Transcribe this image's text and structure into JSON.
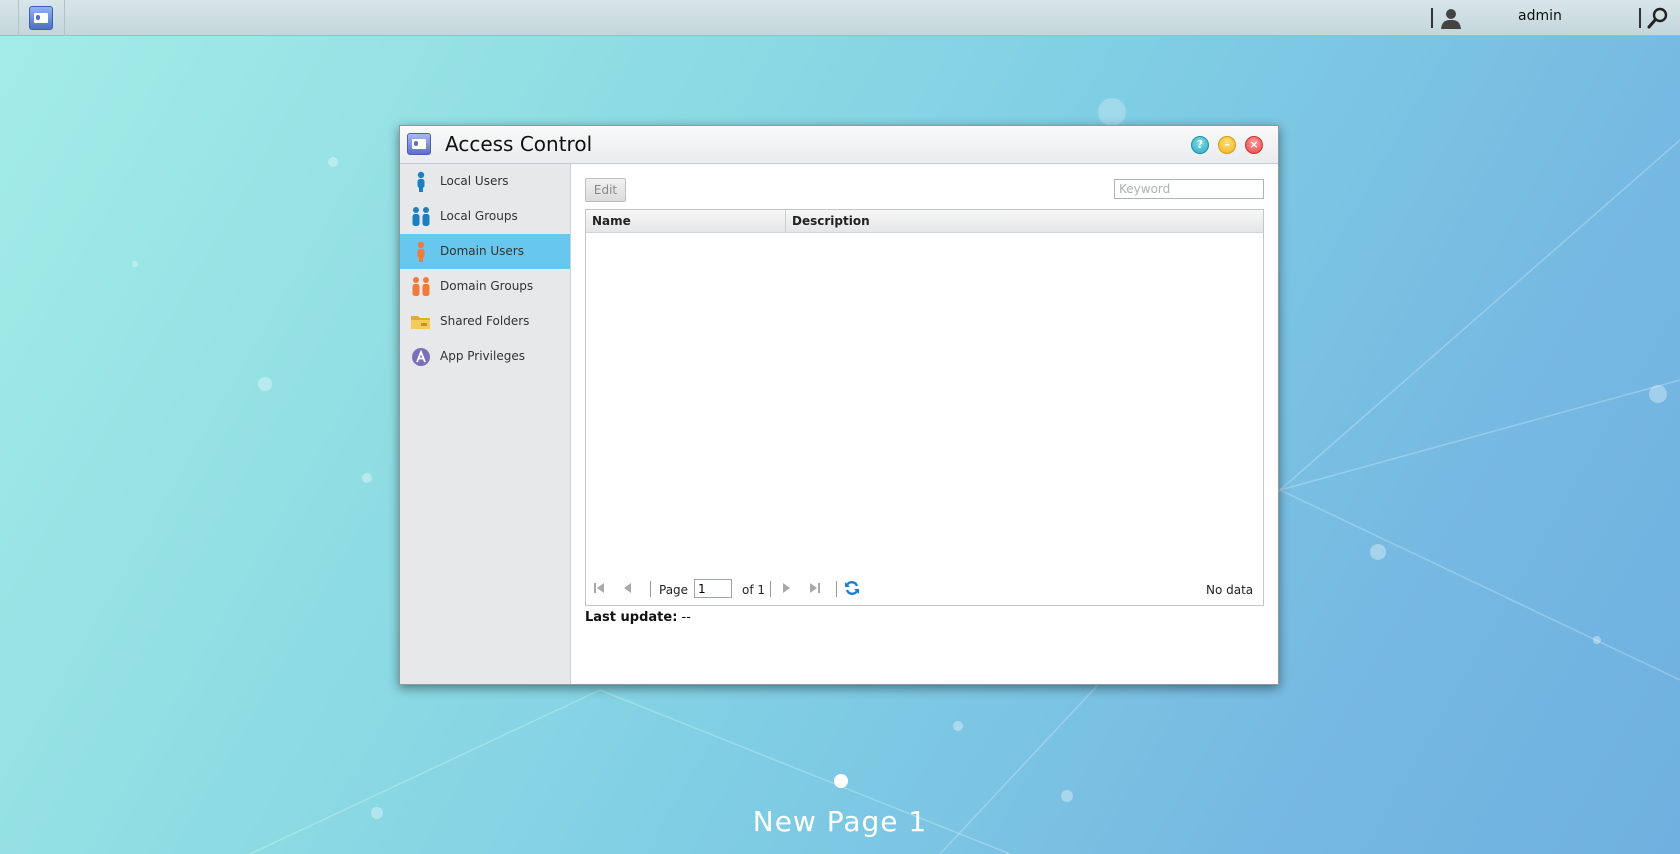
{
  "topbar": {
    "user": {
      "icon": "user-silhouette-icon",
      "name": "admin"
    },
    "app_icon": "access-control-icon",
    "search_icon": "search-icon"
  },
  "window": {
    "title": "Access Control",
    "icon": "access-control-icon",
    "controls": {
      "help": "?",
      "minimize": "–",
      "close": "×"
    }
  },
  "sidebar": {
    "items": [
      {
        "label": "Local Users",
        "icon": "local-user-icon",
        "active": false
      },
      {
        "label": "Local Groups",
        "icon": "local-group-icon",
        "active": false
      },
      {
        "label": "Domain Users",
        "icon": "domain-user-icon",
        "active": true
      },
      {
        "label": "Domain Groups",
        "icon": "domain-group-icon",
        "active": false
      },
      {
        "label": "Shared Folders",
        "icon": "shared-folder-icon",
        "active": false
      },
      {
        "label": "App Privileges",
        "icon": "app-privilege-icon",
        "active": false
      }
    ]
  },
  "toolbar": {
    "edit_label": "Edit",
    "search_placeholder": "Keyword"
  },
  "grid": {
    "columns": [
      "Name",
      "Description"
    ],
    "rows": []
  },
  "pager": {
    "page_label": "Page",
    "page_value": "1",
    "of_label": "of 1",
    "status": "No data"
  },
  "footer": {
    "last_update_label": "Last update:",
    "last_update_value": "--"
  },
  "desktop": {
    "page_name": "New Page 1"
  },
  "colors": {
    "active_item": "#67c7ee",
    "accent_blue": "#1f7fd1"
  }
}
